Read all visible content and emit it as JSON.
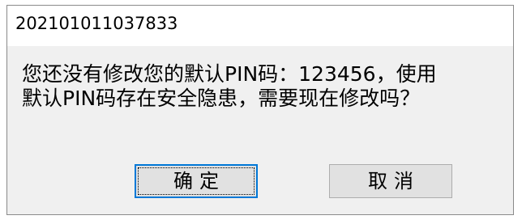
{
  "window": {
    "title": "202101011037833"
  },
  "message": {
    "line1": "您还没有修改您的默认PIN码：123456，使用",
    "line2": "默认PIN码存在安全隐患，需要现在修改吗？"
  },
  "buttons": {
    "ok_label": "确定",
    "cancel_label": "取消"
  },
  "colors": {
    "accent_focus": "#0078d7",
    "dialog_background": "#f0f0f0",
    "button_background": "#e1e1e1"
  }
}
